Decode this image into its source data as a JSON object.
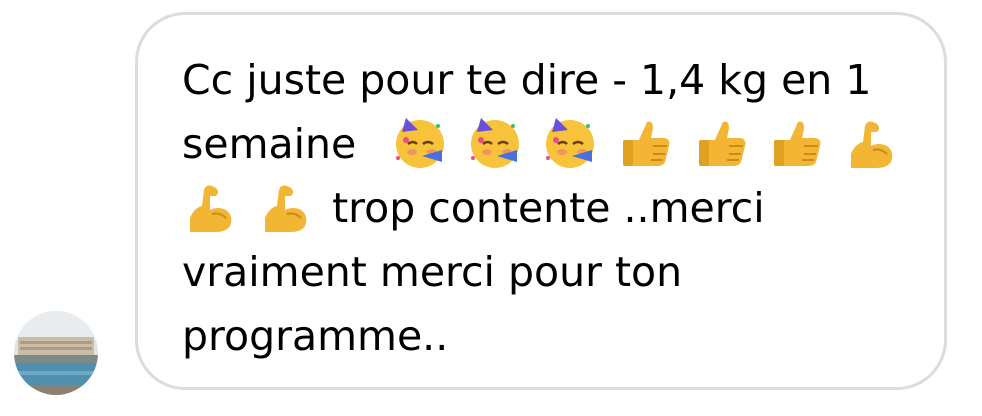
{
  "message": {
    "line1": "Cc juste pour te dire - 1,4 kg en 1",
    "line2": "semaine",
    "line3": "trop contente ..merci",
    "line4": "vraiment merci pour ton",
    "line5": "programme.."
  },
  "emojis": {
    "line2": [
      "partying-face-emoji",
      "partying-face-emoji",
      "partying-face-emoji",
      "thumbs-up-emoji",
      "thumbs-up-emoji",
      "thumbs-up-emoji",
      "flexed-biceps-emoji"
    ],
    "line3": [
      "flexed-biceps-emoji",
      "flexed-biceps-emoji"
    ]
  },
  "colors": {
    "bubble_border": "#dcdcdc",
    "text": "#000000",
    "emoji_yellow": "#f6c33a"
  }
}
